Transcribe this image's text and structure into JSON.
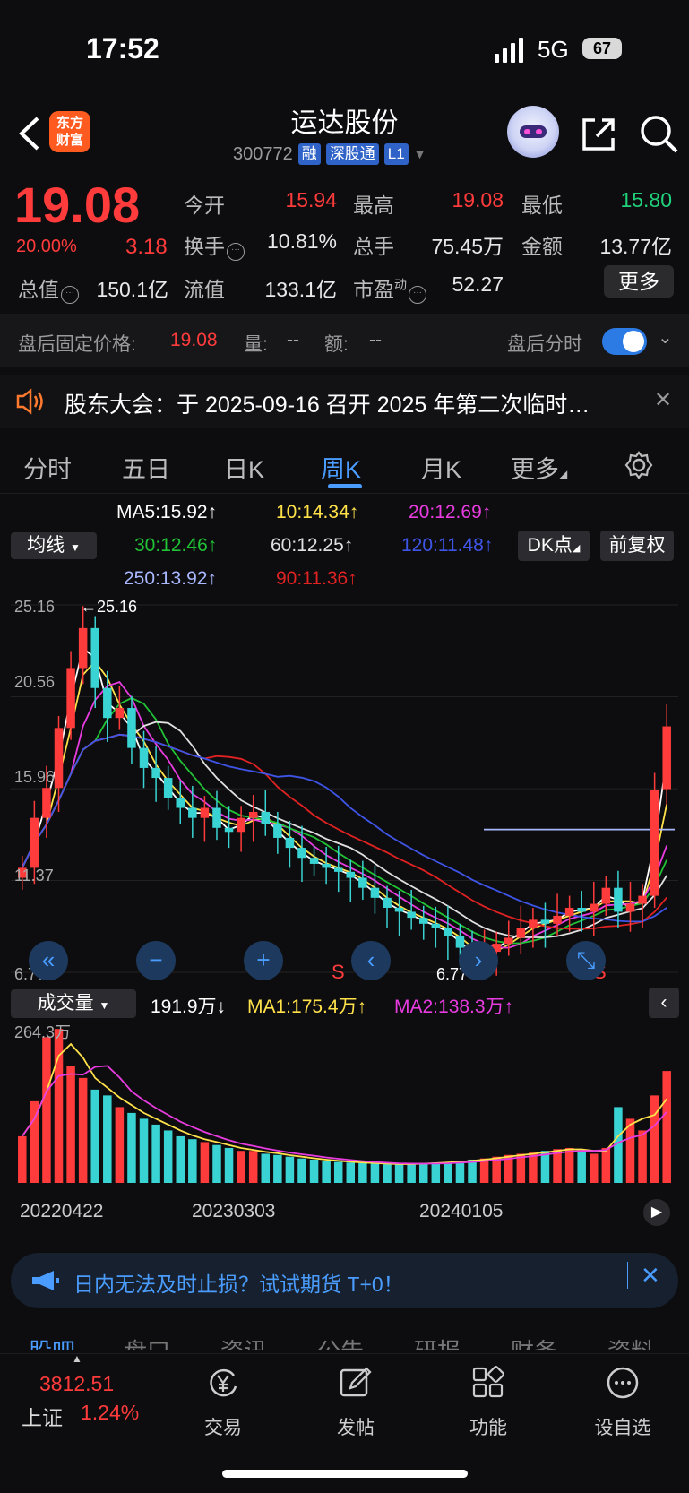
{
  "status": {
    "time": "17:52",
    "network": "5G",
    "battery": "67"
  },
  "header": {
    "logo_line1": "东方",
    "logo_line2": "财富",
    "name": "运达股份",
    "code": "300772",
    "tags": [
      "融",
      "深股通",
      "L1"
    ]
  },
  "quote": {
    "price": "19.08",
    "change_pct": "20.00%",
    "change": "3.18",
    "open_label": "今开",
    "open": "15.94",
    "high_label": "最高",
    "high": "19.08",
    "low_label": "最低",
    "low": "15.80",
    "turnover_label": "换手",
    "turnover": "10.81%",
    "volume_label": "总手",
    "volume": "75.45万",
    "amount_label": "金额",
    "amount": "13.77亿",
    "mcap_label": "总值",
    "mcap": "150.1亿",
    "float_label": "流值",
    "float": "133.1亿",
    "pe_label": "市盈",
    "pe_sup": "动",
    "pe": "52.27",
    "more_label": "更多"
  },
  "after_hours": {
    "label": "盘后固定价格:",
    "price": "19.08",
    "vol_label": "量:",
    "vol": "--",
    "amt_label": "额:",
    "amt": "--",
    "toggle_label": "盘后分时"
  },
  "notice": {
    "text": "股东大会：于 2025-09-16 召开 2025 年第二次临时…"
  },
  "tabs": [
    "分时",
    "五日",
    "日K",
    "周K",
    "月K",
    "更多"
  ],
  "ma_legend": {
    "ma5": "MA5:15.92↑",
    "ma10": "10:14.34↑",
    "ma20": "20:12.69↑",
    "ma30": "30:12.46↑",
    "ma60": "60:12.25↑",
    "ma120": "120:11.48↑",
    "ma250": "250:13.92↑",
    "ma90": "90:11.36↑",
    "select_label": "均线",
    "dk_label": "DK点",
    "fq_label": "前复权"
  },
  "colors": {
    "ma5": "#ffffff",
    "ma10": "#ffe14a",
    "ma20": "#e83ce0",
    "ma30": "#21c236",
    "ma60": "#e0e0e0",
    "ma120": "#3f55e8",
    "ma250": "#a9b8ff",
    "ma90": "#e02222",
    "up": "#ff3b3b",
    "down": "#3ad3d3"
  },
  "volume": {
    "select_label": "成交量",
    "value": "191.9万↓",
    "ma1": "MA1:175.4万↑",
    "ma2": "MA2:138.3万↑",
    "axis_max": "264.3万"
  },
  "chart_data": [
    {
      "type": "candlestick",
      "title": "",
      "y_ticks": [
        "25.16",
        "20.56",
        "15.96",
        "11.37",
        "6.77"
      ],
      "ylim": [
        6.77,
        25.16
      ],
      "annotations": [
        "←25.16",
        "6.77→",
        "S",
        "S"
      ],
      "x_ticks": [
        "20220422",
        "20230303",
        "20240105"
      ],
      "close_approx": [
        12,
        14.5,
        16,
        19,
        22,
        24,
        21,
        19.5,
        20,
        18,
        17,
        16.5,
        15.5,
        15,
        14.5,
        15,
        14,
        13.8,
        14.5,
        14.8,
        14.2,
        13.5,
        13,
        12.5,
        12.2,
        12,
        11.8,
        11.5,
        11,
        10.5,
        10,
        9.8,
        9.5,
        9.2,
        9,
        8.6,
        8,
        7.5,
        7.8,
        8.2,
        8.5,
        9,
        9.4,
        9.2,
        9.6,
        10,
        9.8,
        10.2,
        11,
        9.8,
        10.2,
        10.6,
        15.9,
        19.08
      ]
    },
    {
      "type": "bar",
      "title": "",
      "ylabel": "成交量",
      "ylim": [
        0,
        264.3
      ],
      "values_approx": [
        80,
        140,
        250,
        264,
        200,
        180,
        160,
        150,
        130,
        120,
        110,
        100,
        90,
        80,
        75,
        70,
        65,
        60,
        55,
        55,
        50,
        48,
        45,
        42,
        40,
        38,
        36,
        35,
        34,
        33,
        32,
        32,
        33,
        34,
        35,
        36,
        38,
        40,
        42,
        45,
        48,
        50,
        52,
        55,
        58,
        60,
        55,
        50,
        60,
        130,
        110,
        90,
        150,
        191.9
      ]
    }
  ],
  "ad": {
    "text": "日内无法及时止损？试试期货 T+0！"
  },
  "subnav": [
    "股吧",
    "盘口",
    "资讯",
    "公告",
    "研报",
    "财务",
    "资料"
  ],
  "bottom_nav": {
    "index_value": "3812.51",
    "index_name": "上证",
    "index_pct": "1.24%",
    "trade": "交易",
    "post": "发帖",
    "func": "功能",
    "watch": "设自选"
  }
}
